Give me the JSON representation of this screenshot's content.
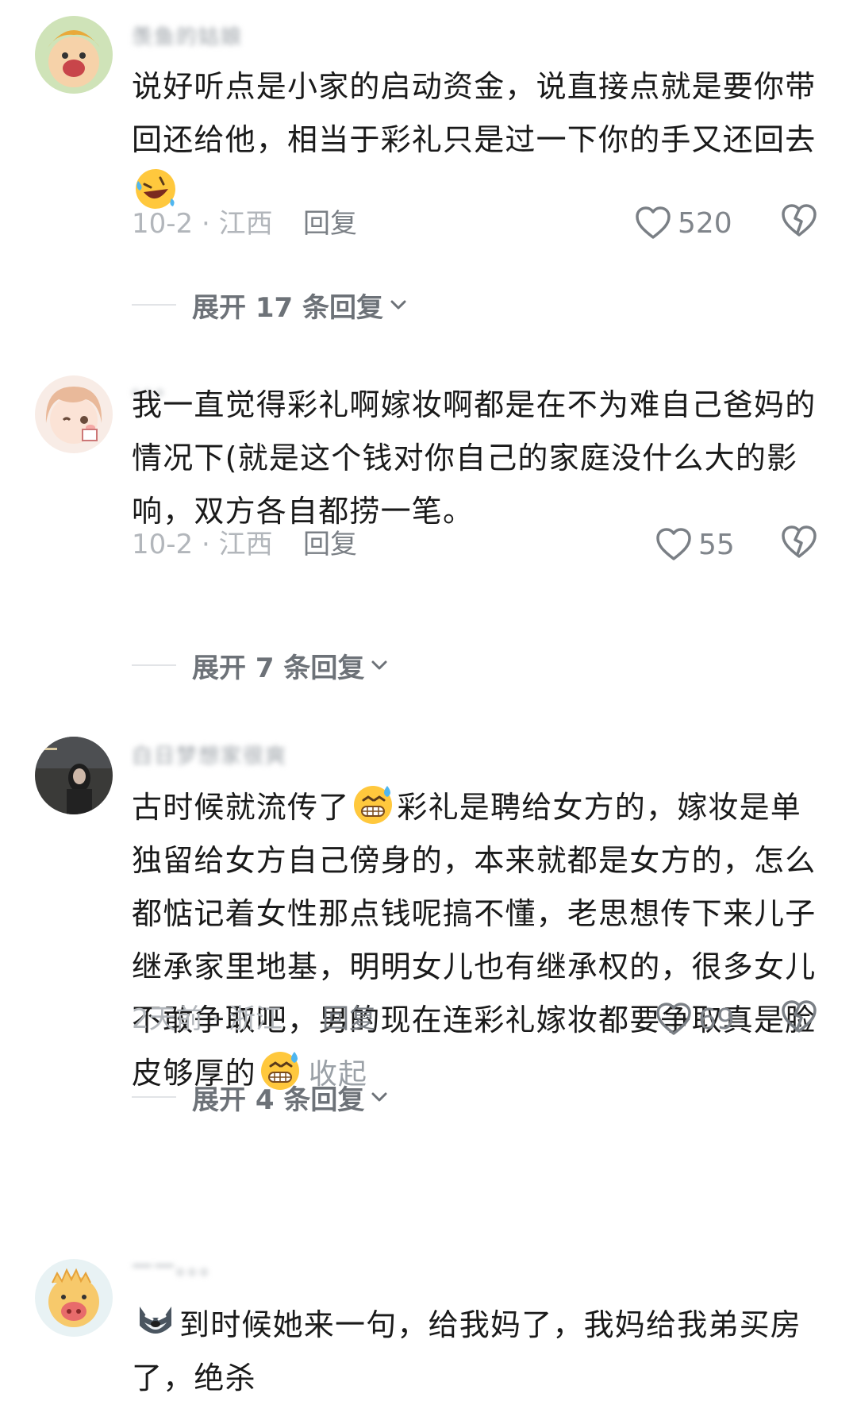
{
  "comments": [
    {
      "username": "羡鱼的姑娘",
      "text_before": "说好听点是小家的启动资金，说直接点就是要你带回还给他，相当于彩礼只是过一下你的手又还回去",
      "emoji": "rofl-emoji",
      "date_location": "10-2 · 江西",
      "reply_label": "回复",
      "likes": "520",
      "expand_label": "展开 17 条回复"
    },
    {
      "username": "。。。",
      "text": "我一直觉得彩礼啊嫁妆啊都是在不为难自己爸妈的情况下(就是这个钱对你自己的家庭没什么大的影响，双方各自都捞一笔。",
      "date_location": "10-2 · 江西",
      "reply_label": "回复",
      "likes": "55",
      "expand_label": "展开 7 条回复"
    },
    {
      "username": "白日梦想家很爽",
      "text_part1": "古时候就流传了",
      "text_part2": "彩礼是聘给女方的，嫁妆是单独留给女方自己傍身的，本来就都是女方的，怎么都惦记着女性那点钱呢搞不懂，老思想传下来儿子继承家里地基，明明女儿也有继承权的，很多女儿不敢争取吧，男的现在连彩礼嫁妆都要争取真是脸皮够厚的",
      "collapse_label": "收起",
      "date_location": "2天前 · 浙江",
      "reply_label": "回复",
      "likes": "69",
      "expand_label": "展开 4 条回复"
    },
    {
      "username": "一一。。。",
      "text": "到时候她来一句，给我妈了，我妈给我弟买房了，绝杀"
    }
  ],
  "colors": {
    "text": "#1a1a1a",
    "meta": "#b2b6bb",
    "secondary": "#7a7f85",
    "divider": "#e2e4e7"
  },
  "icons": [
    "heart-icon",
    "dislike-broken-heart-icon",
    "chevron-down-icon",
    "rofl-emoji",
    "grin-sweat-emoji",
    "wolf-emoji"
  ]
}
